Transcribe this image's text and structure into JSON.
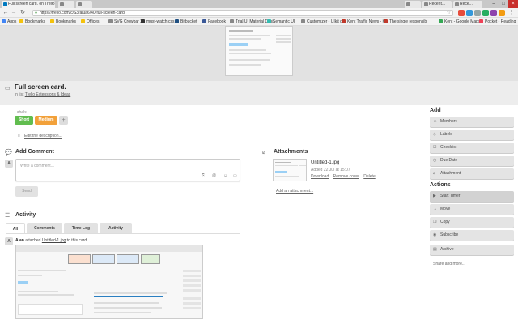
{
  "browser": {
    "tabs": [
      {
        "label": "Full screen card. on Trello",
        "active": true
      },
      {
        "label": "",
        "active": false
      },
      {
        "label": "",
        "active": false
      },
      {
        "label": "",
        "active": false
      },
      {
        "label": "Recent...",
        "active": false
      },
      {
        "label": "Rece...",
        "active": false
      }
    ],
    "url": "https://trello.com/c/S3faiua6/40-full-screen-card",
    "bookmarks": [
      {
        "label": "Apps",
        "color": "#4285f4"
      },
      {
        "label": "Bookmarks",
        "color": "#f4c20d"
      },
      {
        "label": "Bookmarks",
        "color": "#f4c20d"
      },
      {
        "label": "Offices",
        "color": "#f4c20d"
      },
      {
        "label": "SVG Crowbar 2",
        "color": "#888888"
      },
      {
        "label": "must-watch css",
        "color": "#333333"
      },
      {
        "label": "Bitbucket",
        "color": "#205081"
      },
      {
        "label": "Facebook",
        "color": "#3b5998"
      },
      {
        "label": "Trial UI Material Desi",
        "color": "#888888"
      },
      {
        "label": "Semantic UI",
        "color": "#35bdb2"
      },
      {
        "label": "Customizer - UIkit d",
        "color": "#888888"
      },
      {
        "label": "Kent Traffic News - K",
        "color": "#c0392b"
      },
      {
        "label": "The single responsib",
        "color": "#c0392b"
      },
      {
        "label": "Kent - Google Maps",
        "color": "#34a853"
      },
      {
        "label": "Pocket - Reading",
        "color": "#ef4056"
      }
    ]
  },
  "card": {
    "title": "Full screen card.",
    "list_prefix": "in list",
    "list_name": "Trello Extensions & Ideas"
  },
  "labels": {
    "heading": "Labels",
    "items": [
      {
        "text": "Short",
        "color": "#61bd4f"
      },
      {
        "text": "Medium",
        "color": "#f2a13a"
      }
    ],
    "add": "+"
  },
  "description": {
    "edit_link": "Edit the description..."
  },
  "comment": {
    "heading": "Add Comment",
    "avatar": "A",
    "placeholder": "Write a comment...",
    "send": "Send"
  },
  "attachments": {
    "heading": "Attachments",
    "file_name": "Untitled-1.jpg",
    "added": "Added 22 Jul at 15:07",
    "actions": [
      "Download",
      "Remove cover",
      "Delete"
    ],
    "add_link": "Add an attachment..."
  },
  "activity": {
    "heading": "Activity",
    "tabs": [
      "All",
      "Comments",
      "Time Log",
      "Activity"
    ],
    "entry_user": "Alan",
    "entry_verb": "attached",
    "entry_file": "Untitled-1.jpg",
    "entry_suffix": "to this card"
  },
  "sidebar": {
    "add_heading": "Add",
    "add_items": [
      "Members",
      "Labels",
      "Checklist",
      "Due Date",
      "Attachment"
    ],
    "actions_heading": "Actions",
    "action_items": [
      "Start Timer",
      "Move",
      "Copy",
      "Subscribe",
      "Archive"
    ],
    "share": "Share and more..."
  }
}
